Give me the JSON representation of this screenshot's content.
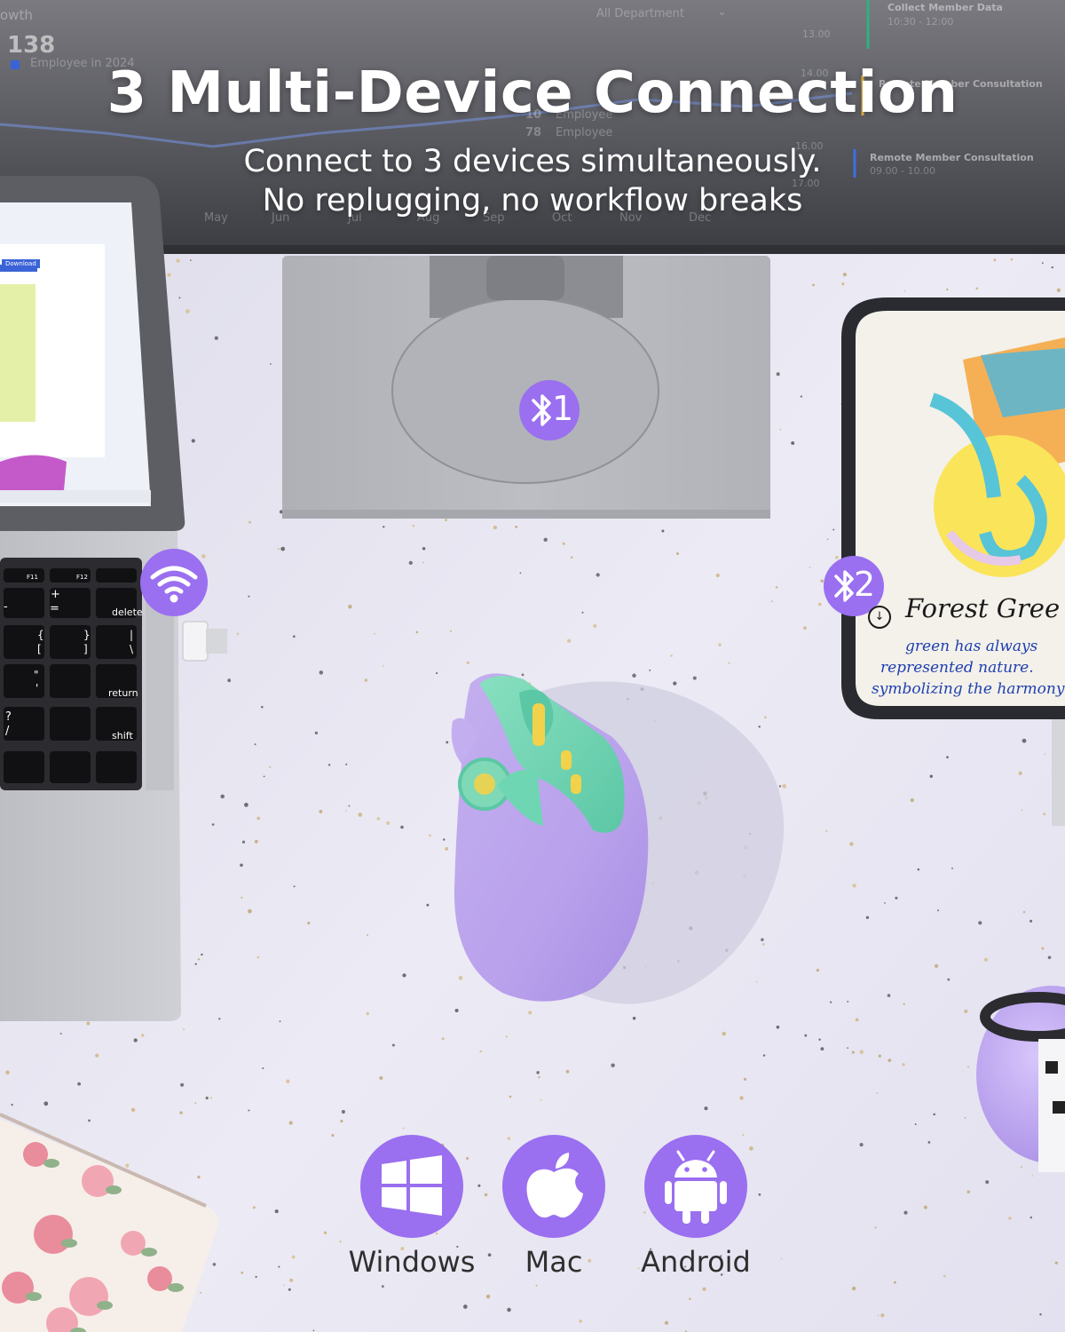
{
  "headline": {
    "title": "3 Multi-Device Connection",
    "subtitle_line1": "Connect to 3 devices simultaneously.",
    "subtitle_line2": "No replugging, no workflow breaks"
  },
  "monitor_screen": {
    "growth_label": "owth",
    "employee_count": "138",
    "legend_text": "Employee in 2024",
    "department_filter": "All Department",
    "schedule_items": [
      {
        "title": "Collect Member Data",
        "time": "10:30 - 12:00"
      },
      {
        "title": "Remote Member Consultation"
      },
      {
        "title": "Remote Member Consultation",
        "time": "09.00 - 10.00"
      }
    ],
    "tooltip_values": [
      "10",
      "78"
    ],
    "tooltip_label": "Employee",
    "time_labels": [
      "13.00",
      "14.00",
      "16.00",
      "17.00"
    ],
    "month_labels": [
      "May",
      "Jun",
      "Jul",
      "Aug",
      "Sep",
      "Oct",
      "Nov",
      "Dec"
    ]
  },
  "laptop_screen": {
    "download_button": "Download"
  },
  "keyboard_keys": {
    "f11": "F11",
    "f12": "F12",
    "plus": "+",
    "equals": "=",
    "minus": "-",
    "delete": "delete",
    "brace_open": "{",
    "brace_close": "}",
    "bracket_open": "[",
    "bracket_close": "]",
    "pipe": "|",
    "backslash": "\\",
    "quote": "\"",
    "apostrophe": "'",
    "return": "return",
    "question": "?",
    "slash": "/",
    "shift": "shift"
  },
  "connection_badges": {
    "bluetooth_1": "1",
    "bluetooth_2": "2"
  },
  "tablet_screen": {
    "heading": "Forest Gree",
    "line1": "green has always",
    "line2": "represented nature.",
    "line3": "symbolizing the harmony"
  },
  "os_support": [
    {
      "label": "Windows",
      "icon": "windows-icon"
    },
    {
      "label": "Mac",
      "icon": "apple-icon"
    },
    {
      "label": "Android",
      "icon": "android-icon"
    }
  ],
  "colors": {
    "badge_purple": "#9a6ff0",
    "mouse_lilac": "#c9b6f2",
    "mouse_mint": "#6fd6b3",
    "desk": "#e9e8f2"
  }
}
